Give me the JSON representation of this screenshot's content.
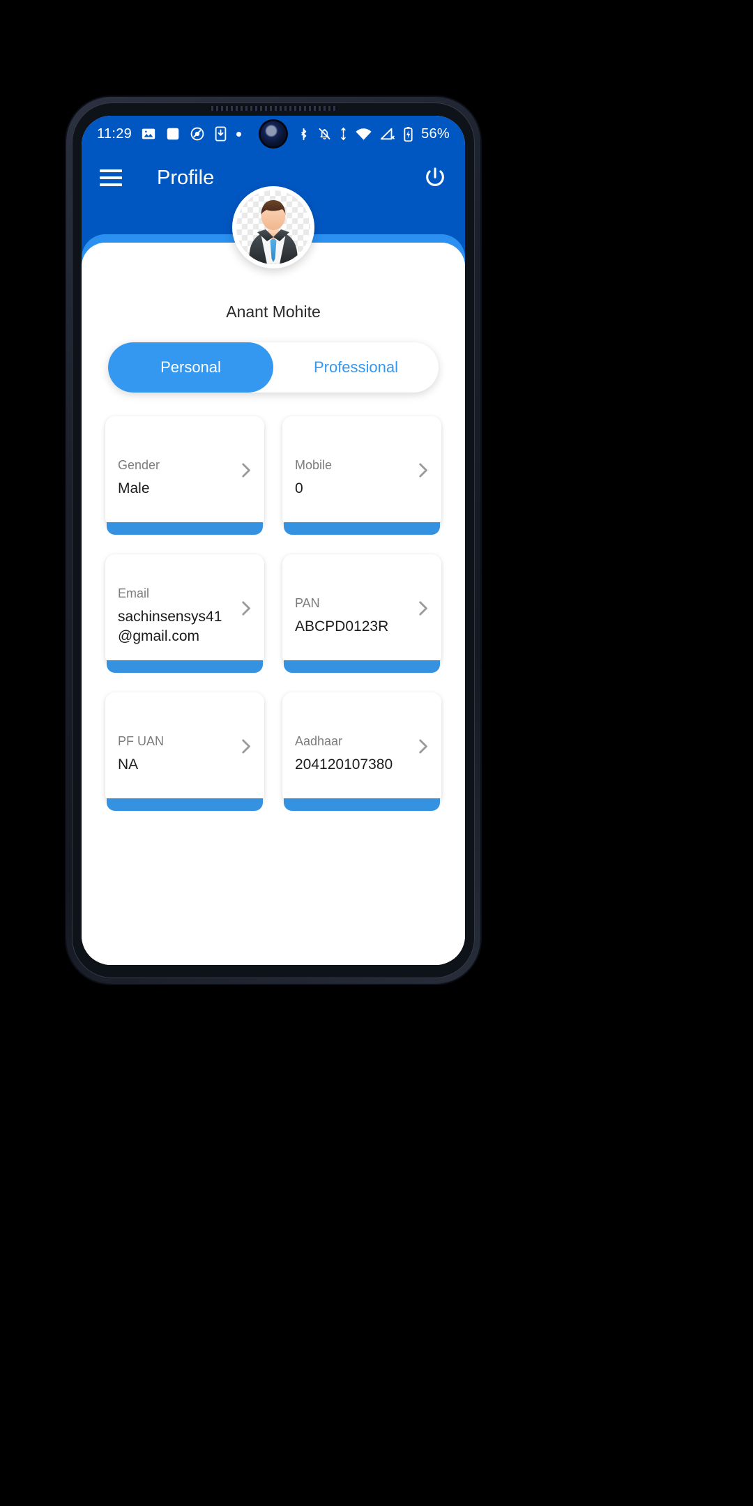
{
  "statusbar": {
    "time": "11:29",
    "left_icons": [
      "image-icon",
      "white-square-icon",
      "no-entry-circle-icon",
      "download-to-phone-icon",
      "dot-icon"
    ],
    "right_icons": [
      "bluetooth-icon",
      "notifications-silenced-icon",
      "data-transfer-icon",
      "wifi-icon",
      "signal-no-service-icon",
      "battery-charging-icon"
    ],
    "battery_percent": "56%"
  },
  "appbar": {
    "menu_icon": "hamburger-menu-icon",
    "title": "Profile",
    "power_icon": "power-icon"
  },
  "profile": {
    "avatar_icon": "businessman-avatar",
    "name": "Anant Mohite"
  },
  "tabs": [
    {
      "label": "Personal",
      "active": true
    },
    {
      "label": "Professional",
      "active": false
    }
  ],
  "cards": [
    {
      "label": "Gender",
      "value": "Male"
    },
    {
      "label": "Mobile",
      "value": "0"
    },
    {
      "label": "Email",
      "value": "sachinsensys41@gmail.com"
    },
    {
      "label": "PAN",
      "value": "ABCPD0123R"
    },
    {
      "label": "PF UAN",
      "value": "NA"
    },
    {
      "label": "Aadhaar",
      "value": "204120107380"
    }
  ],
  "colors": {
    "header_blue": "#0057c2",
    "accent_blue": "#2b90f0",
    "tab_active": "#3498f0",
    "card_strip": "#3492e0",
    "label_gray": "#7c7c7c"
  }
}
